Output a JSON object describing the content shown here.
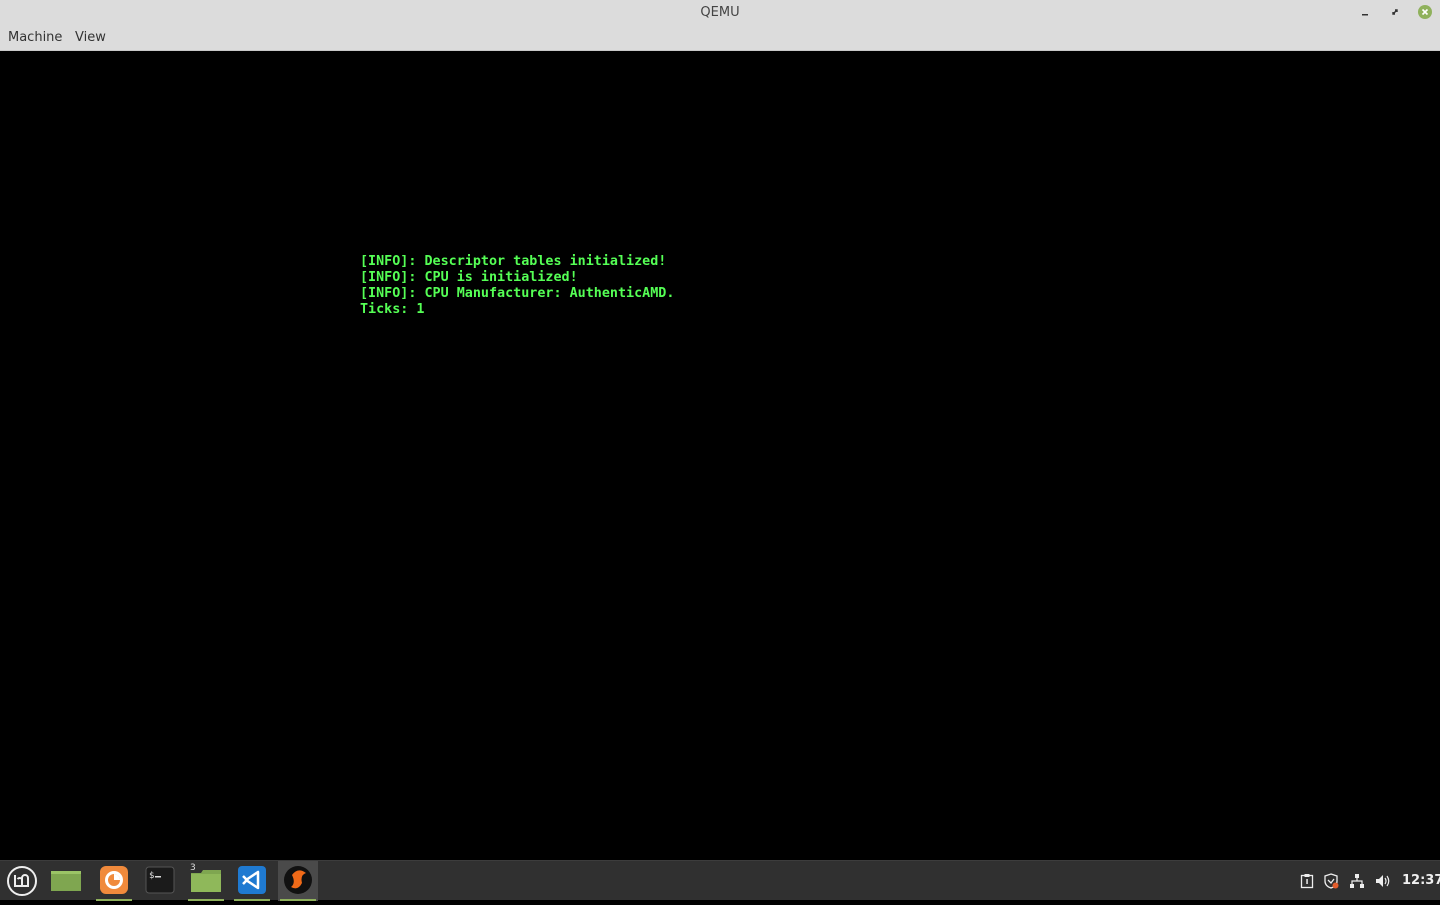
{
  "window": {
    "title": "QEMU"
  },
  "menubar": {
    "items": [
      "Machine",
      "View"
    ]
  },
  "console": {
    "lines": [
      "[INFO]: Descriptor tables initialized!",
      "[INFO]: CPU is initialized!",
      "[INFO]: CPU Manufacturer: AuthenticAMD.",
      "Ticks: 1"
    ],
    "text_color": "#55ff55"
  },
  "taskbar": {
    "apps": [
      {
        "icon": "mint-menu-icon"
      },
      {
        "icon": "show-desktop-icon"
      },
      {
        "icon": "firefox-icon",
        "running": true
      },
      {
        "icon": "terminal-icon"
      },
      {
        "icon": "files-icon",
        "badge": "3",
        "running": true
      },
      {
        "icon": "vscode-icon",
        "running": true
      },
      {
        "icon": "qemu-icon",
        "running": true,
        "active": true
      }
    ],
    "tray": [
      "clipboard-icon",
      "update-shield-icon",
      "network-icon",
      "volume-icon"
    ],
    "clock": "12:37"
  },
  "colors": {
    "accent": "#8fb15c",
    "close_button": "#8fb15c",
    "taskbar": "#303030"
  }
}
